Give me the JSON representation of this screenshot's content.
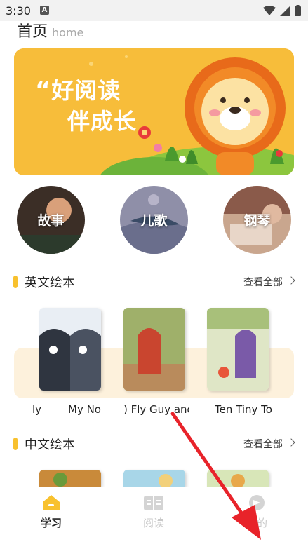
{
  "status_bar": {
    "time": "3:30"
  },
  "header": {
    "title": "首页",
    "subtitle": "home"
  },
  "banner": {
    "quote_mark": "“",
    "line1": "好阅读",
    "line2": "伴成长"
  },
  "categories": [
    {
      "label": "故事"
    },
    {
      "label": "儿歌"
    },
    {
      "label": "钢琴"
    }
  ],
  "english_section": {
    "title": "英文绘本",
    "more": "查看全部",
    "books": [
      {
        "title": "ly"
      },
      {
        "title": "My No"
      },
      {
        "title": ") Fly Guy and"
      },
      {
        "title": "Ten Tiny To"
      }
    ]
  },
  "chinese_section": {
    "title": "中文绘本",
    "more": "查看全部"
  },
  "tabbar": {
    "tabs": [
      {
        "label": "学习",
        "icon": "home-icon",
        "active": true
      },
      {
        "label": "阅读",
        "icon": "book-icon",
        "active": false
      },
      {
        "label": "我的",
        "icon": "profile-icon",
        "active": false
      }
    ]
  },
  "colors": {
    "accent": "#f8c12e",
    "banner": "#f7bd3a",
    "annotation_arrow": "#e8232a"
  }
}
